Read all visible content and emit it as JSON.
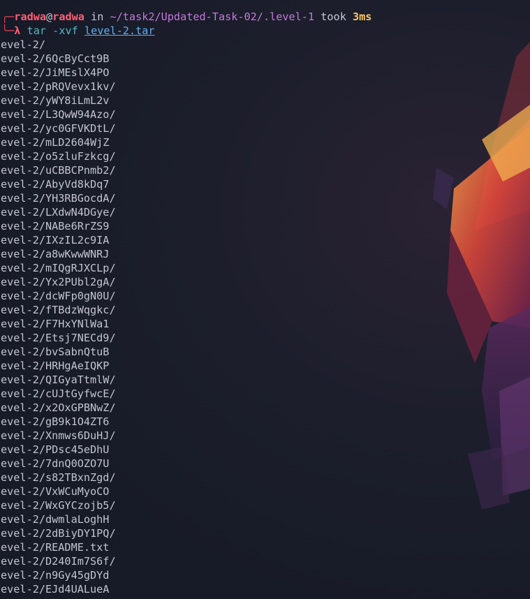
{
  "prompt": {
    "user": "radwa",
    "at": "@",
    "host": "radwa",
    "in_word": "in",
    "cwd": "~/task2/Updated-Task-02/.level-1",
    "took_word": "took",
    "duration": "3ms",
    "symbol": "λ",
    "command": "tar -xvf",
    "argument": "level-2.tar"
  },
  "output_lines": [
    "evel-2/",
    "evel-2/6QcByCct9B",
    "evel-2/JiMEslX4PO",
    "evel-2/pRQVevx1kv/",
    "evel-2/yWY8iLmL2v",
    "evel-2/L3QwW94Azo/",
    "evel-2/yc0GFVKDtL/",
    "evel-2/mLD2604WjZ",
    "evel-2/o5zluFzkcg/",
    "evel-2/uCBBCPnmb2/",
    "evel-2/AbyVd8kDq7",
    "evel-2/YH3RBGocdA/",
    "evel-2/LXdwN4DGye/",
    "evel-2/NABe6RrZS9",
    "evel-2/IXzIL2c9IA",
    "evel-2/a8wKwwWNRJ",
    "evel-2/mIQgRJXCLp/",
    "evel-2/Yx2PUbl2gA/",
    "evel-2/dcWFp0gN0U/",
    "evel-2/fTBdzWqgkc/",
    "evel-2/F7HxYNlWa1",
    "evel-2/Etsj7NECd9/",
    "evel-2/bvSabnQtuB",
    "evel-2/HRHgAeIQKP",
    "evel-2/QIGyaTtmlW/",
    "evel-2/cUJtGyfwcE/",
    "evel-2/x2OxGPBNwZ/",
    "evel-2/gB9k1O4ZT6",
    "evel-2/Xnmws6DuHJ/",
    "evel-2/PDsc45eDhU",
    "evel-2/7dnQ0OZO7U",
    "evel-2/s82TBxnZgd/",
    "evel-2/VxWCuMyoCO",
    "evel-2/WxGYCzojb5/",
    "evel-2/dwmlaLoghH",
    "evel-2/2dBiyDY1PQ/",
    "evel-2/README.txt",
    "evel-2/D240Im7S6f/",
    "evel-2/n9Gy45gDYd",
    "evel-2/EJd4UALueA"
  ],
  "colors": {
    "background": "#171a27",
    "user": "#ff5f76",
    "path": "#c678dd",
    "duration": "#ffc85a",
    "command": "#56b6c2",
    "argument": "#61afef",
    "text": "#c2c4d2"
  }
}
